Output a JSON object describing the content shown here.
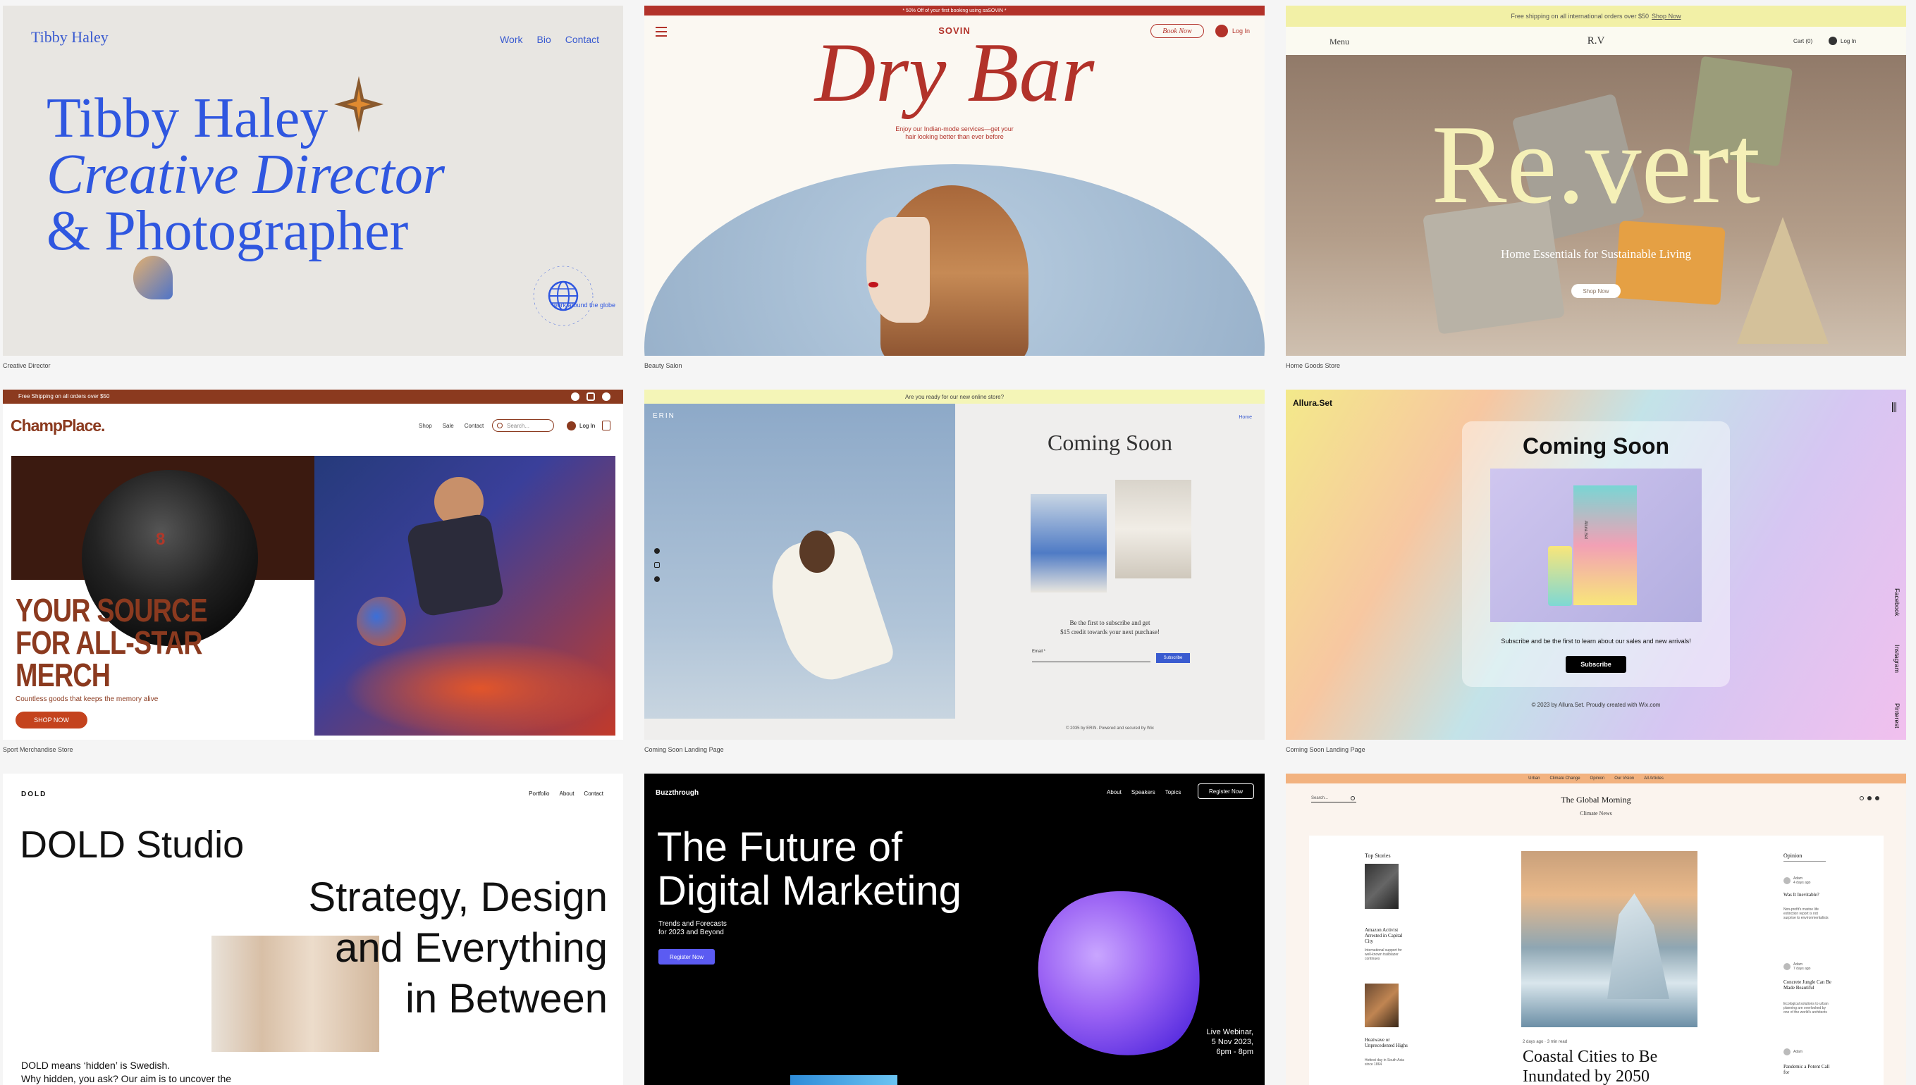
{
  "captions": {
    "c1": "Creative Director",
    "c2": "Beauty Salon",
    "c3": "Home Goods Store",
    "c4": "Sport Merchandise Store",
    "c5": "Coming Soon Landing Page",
    "c6": "Coming Soon Landing Page"
  },
  "c1": {
    "logo": "Tibby Haley",
    "nav": [
      "Work",
      "Bio",
      "Contact"
    ],
    "headline": [
      "Tibby Haley",
      "Creative Director",
      "& Photographer"
    ],
    "badge": "work around the globe"
  },
  "c2": {
    "promo": "* 50% Off of your first booking using saSOVIN *",
    "brand": "SOVIN",
    "book": "Book Now",
    "login": "Log In",
    "title": "Dry Bar",
    "sub": [
      "Enjoy our Indian-mode services—get your",
      "hair looking better than ever before"
    ]
  },
  "c3": {
    "promo": "Free shipping on all international orders over $50",
    "promo_link": "Shop Now",
    "menu": "Menu",
    "logo": "R.V",
    "cart": "Cart (0)",
    "login": "Log In",
    "title": "Re.vert",
    "sub": "Home Essentials for Sustainable Living",
    "cta": "Shop Now"
  },
  "c4": {
    "promo": "Free Shipping on all orders over $50",
    "logo": "ChampPlace.",
    "nav": [
      "Shop",
      "Sale",
      "Contact"
    ],
    "search": "Search...",
    "login": "Log In",
    "headline": [
      "YOUR SOURCE",
      "FOR ALL-STAR",
      "MERCH"
    ],
    "sub": "Countless goods that keeps the memory alive",
    "cta": "SHOP NOW",
    "ball_number": "8"
  },
  "c5": {
    "promo": "Are you ready for our new online store?",
    "brand": "ERIN",
    "home": "Home",
    "title": "Coming Soon",
    "text": [
      "Be the first to subscribe and get",
      "$15 credit towards your next purchase!"
    ],
    "email_label": "Email *",
    "subscribe": "Subscribe",
    "footer": "© 2035 by ERIN. Powered and secured by Wix"
  },
  "c6": {
    "logo": "Allura.Set",
    "title": "Coming Soon",
    "text": "Subscribe and be the first to learn about our sales and new arrivals!",
    "subscribe": "Subscribe",
    "footer": "© 2023 by Allura.Set. Proudly created with Wix.com",
    "social": [
      "Facebook",
      "Instagram",
      "Pinterest"
    ],
    "box_label": "Allura.Set"
  },
  "c7": {
    "logo": "DOLD",
    "nav": [
      "Portfolio",
      "About",
      "Contact"
    ],
    "title": "DOLD Studio",
    "tag": [
      "Strategy, Design",
      "and Everything",
      "in Between"
    ],
    "body": [
      "DOLD means ‘hidden’ is Swedish.",
      "Why hidden, you ask? Our aim is to uncover the"
    ]
  },
  "c8": {
    "logo": "Buzzthrough",
    "nav": [
      "About",
      "Speakers",
      "Topics"
    ],
    "register_top": "Register Now",
    "title": [
      "The Future of",
      "Digital Marketing"
    ],
    "sub": [
      "Trends and Forecasts",
      "for 2023 and Beyond"
    ],
    "register": "Register Now",
    "event": [
      "Live Webinar,",
      "5 Nov 2023,",
      "6pm - 8pm"
    ]
  },
  "c9": {
    "topnav": [
      "Urban",
      "Climate Change",
      "Opinion",
      "Our Vision",
      "All Articles"
    ],
    "search": "Search...",
    "title": "The Global Morning",
    "section": "Climate News",
    "left_head": "Top Stories",
    "left_items": [
      {
        "title": "Amazon Activist Arrested in Capital City",
        "text": "International support for well-known trailblazer continues"
      },
      {
        "title": "Heatwave or Unprecedented Highs",
        "text": "Hottest day in South Asia since 1864"
      }
    ],
    "right_head": "Opinion",
    "right_items": [
      {
        "author": "Adam",
        "time": "4 days ago",
        "title": "Was It Inevitable?",
        "text": "Non-profit's marine life extinction report is not surprise to environmentalists"
      },
      {
        "author": "Adam",
        "time": "7 days ago",
        "title": "Concrete Jungle Can Be Made Beautiful",
        "text": "Ecological solutions to urban planning are overlooked by one of the world's architects"
      },
      {
        "author": "Adam",
        "time": "",
        "title": "Pandemic a Potent Call for",
        "text": ""
      }
    ],
    "main_meta": "2 days ago · 3 min read",
    "main_title": [
      "Coastal Cities to Be",
      "Inundated by 2050"
    ]
  }
}
